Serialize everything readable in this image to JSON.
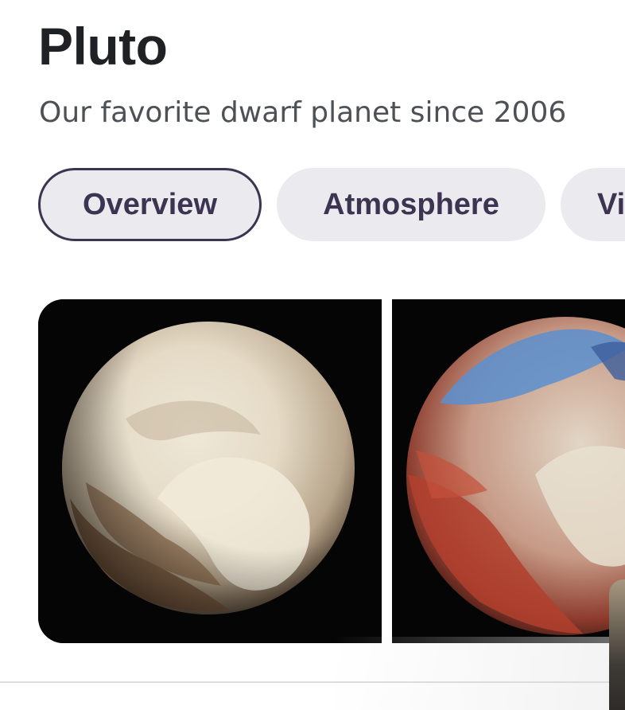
{
  "header": {
    "title": "Pluto",
    "subtitle": "Our favorite dwarf planet since 2006"
  },
  "tabs": [
    {
      "label": "Overview",
      "active": true
    },
    {
      "label": "Atmosphere",
      "active": false
    },
    {
      "label": "Vi",
      "active": false
    }
  ],
  "images": [
    {
      "name": "pluto-natural-color",
      "kind": "true-color photo"
    },
    {
      "name": "pluto-enhanced-color",
      "kind": "enhanced-color photo"
    }
  ],
  "colors": {
    "tab_bg": "#ebebef",
    "tab_text": "#3c3450",
    "title": "#202124",
    "subtitle": "#4d5156"
  }
}
